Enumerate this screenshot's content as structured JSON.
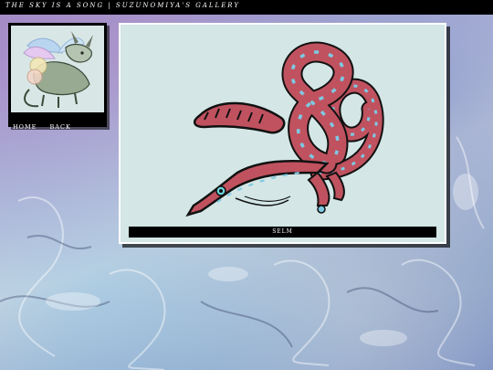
{
  "site": {
    "title": "THE SKY IS A SONG | SUZUNOMIYA'S GALLERY"
  },
  "nav": {
    "home_label": "HOME",
    "back_label": "BACK"
  },
  "gallery": {
    "caption": "SELM"
  },
  "colors": {
    "bar": "#000000",
    "panel_bg": "#d4e6e6",
    "creature_body": "#c0525f",
    "creature_stripe": "#7ec9e3"
  }
}
